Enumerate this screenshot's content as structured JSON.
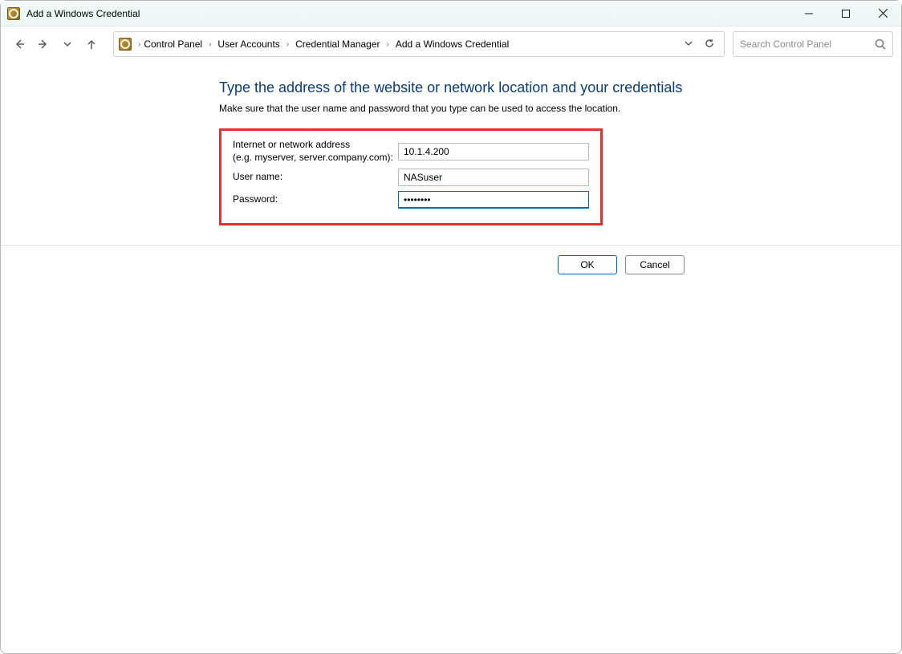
{
  "window": {
    "title": "Add a Windows Credential"
  },
  "breadcrumb": {
    "items": [
      "Control Panel",
      "User Accounts",
      "Credential Manager",
      "Add a Windows Credential"
    ]
  },
  "search": {
    "placeholder": "Search Control Panel"
  },
  "page": {
    "heading": "Type the address of the website or network location and your credentials",
    "subtext": "Make sure that the user name and password that you type can be used to access the location."
  },
  "form": {
    "address_label_line1": "Internet or network address",
    "address_label_line2": "(e.g. myserver, server.company.com):",
    "address_value": "10.1.4.200",
    "username_label": "User name:",
    "username_value": "NASuser",
    "password_label": "Password:",
    "password_value": "••••••••"
  },
  "buttons": {
    "ok": "OK",
    "cancel": "Cancel"
  }
}
